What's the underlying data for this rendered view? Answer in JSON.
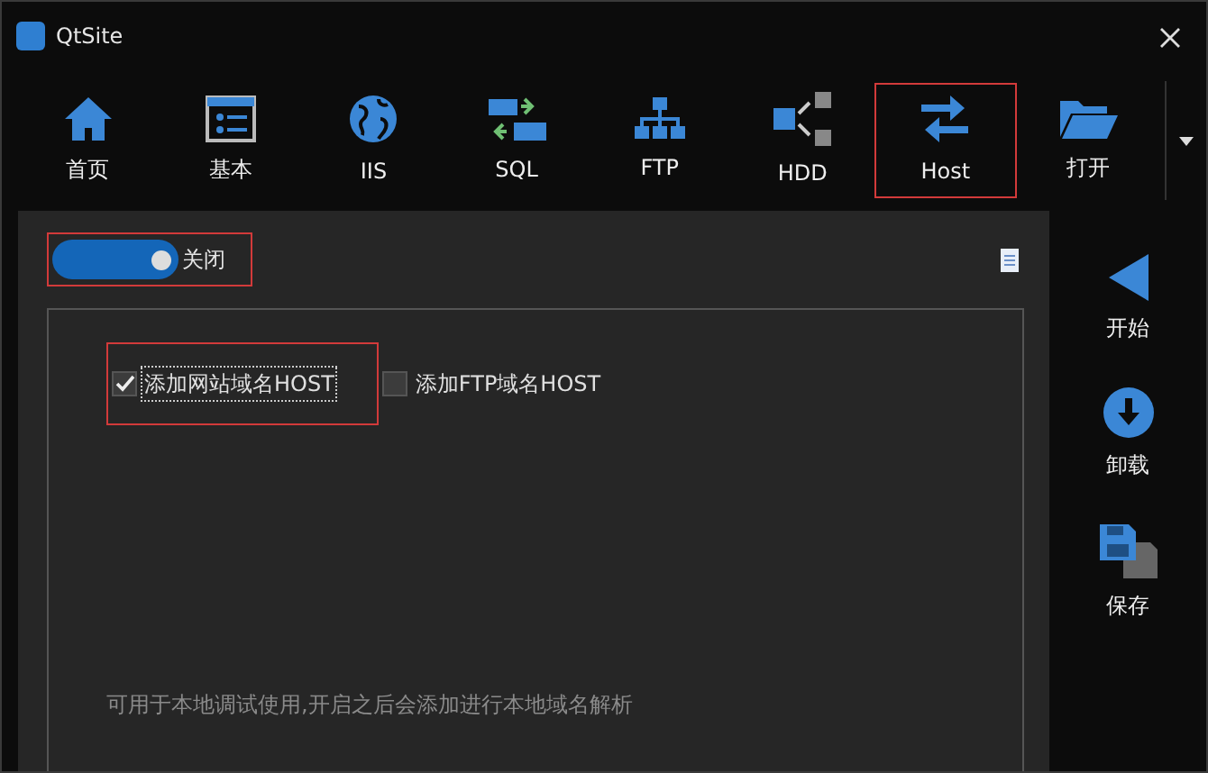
{
  "window": {
    "title": "QtSite"
  },
  "toolbar": [
    {
      "label": "首页",
      "kind": "home",
      "selected": false
    },
    {
      "label": "基本",
      "kind": "form",
      "selected": false
    },
    {
      "label": "IIS",
      "kind": "globe",
      "selected": false
    },
    {
      "label": "SQL",
      "kind": "sync",
      "selected": false
    },
    {
      "label": "FTP",
      "kind": "tree",
      "selected": false
    },
    {
      "label": "HDD",
      "kind": "share",
      "selected": false
    },
    {
      "label": "Host",
      "kind": "swap",
      "selected": true
    },
    {
      "label": "打开",
      "kind": "folder",
      "selected": false
    }
  ],
  "toggle": {
    "label": "关闭",
    "on": true,
    "highlighted": true
  },
  "options": [
    {
      "label": "添加网站域名HOST",
      "checked": true,
      "focused": true,
      "highlighted": true
    },
    {
      "label": "添加FTP域名HOST",
      "checked": false,
      "focused": false,
      "highlighted": false
    }
  ],
  "hint": "可用于本地调试使用,开启之后会添加进行本地域名解析",
  "sidebar": [
    {
      "label": "开始",
      "kind": "play"
    },
    {
      "label": "卸载",
      "kind": "download"
    },
    {
      "label": "保存",
      "kind": "save"
    }
  ]
}
